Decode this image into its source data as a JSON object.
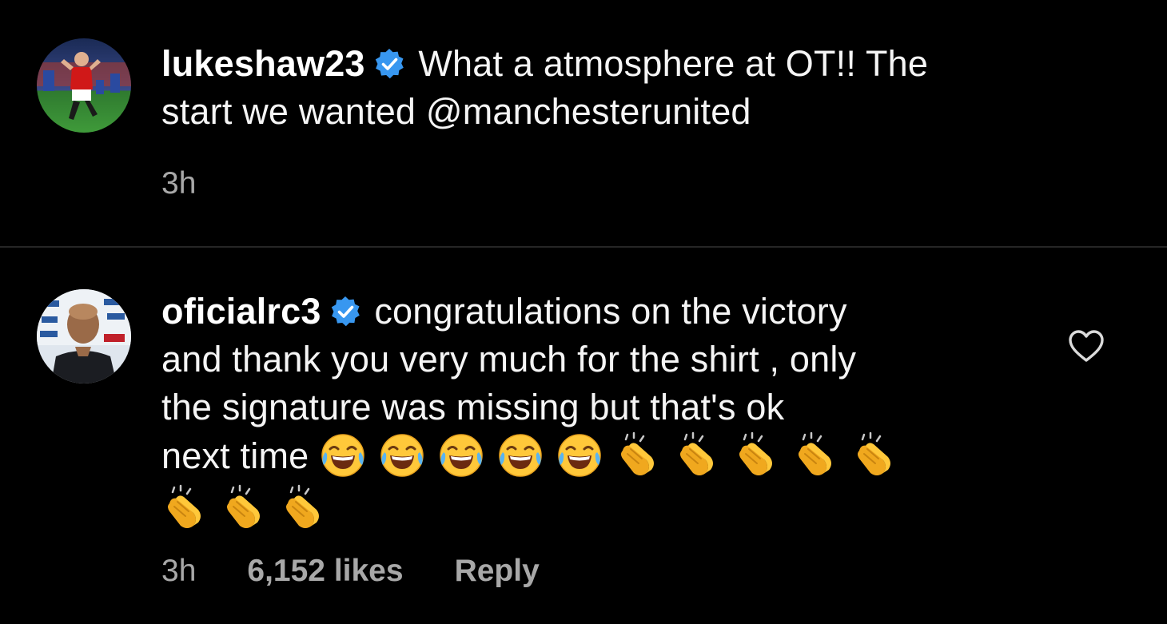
{
  "post": {
    "username": "lukeshaw23",
    "text_line1": "What a atmosphere at OT!! The",
    "text_line2": "start we wanted @manchesterunited",
    "time": "3h",
    "avatar_icon": "profile-photo-player-on-pitch",
    "verified_icon": "verified-badge-icon"
  },
  "comment": {
    "username": "oficialrc3",
    "text_line1": "congratulations on the victory",
    "text_line2": "and thank you very much for the shirt , only",
    "text_line3": "the signature was missing but that's ok",
    "text_line4": "next time",
    "emojis": {
      "laughing_count": 5,
      "clapping_row1_count": 5,
      "clapping_row2_count": 3,
      "laughing_icon": "face-with-tears-of-joy-emoji",
      "clapping_icon": "clapping-hands-emoji"
    },
    "time": "3h",
    "likes": "6,152 likes",
    "reply_label": "Reply",
    "avatar_icon": "profile-photo-man-at-press-conference",
    "like_icon": "heart-outline-icon"
  },
  "colors": {
    "background": "#000000",
    "text": "#f5f5f5",
    "meta_text": "#a8a8a8",
    "verified_blue": "#3897f0",
    "divider": "#262626"
  }
}
